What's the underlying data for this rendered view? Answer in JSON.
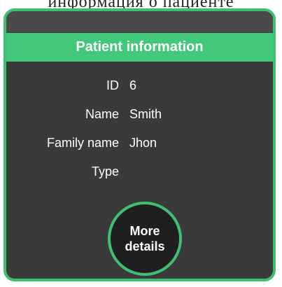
{
  "background_text": "информация о пациенте",
  "card": {
    "title": "Patient information",
    "fields": [
      {
        "label": "ID",
        "value": "6"
      },
      {
        "label": "Name",
        "value": "Smith"
      },
      {
        "label": "Family name",
        "value": "Jhon"
      },
      {
        "label": "Type",
        "value": ""
      }
    ],
    "more_button": {
      "line1": "More",
      "line2": "details"
    }
  },
  "colors": {
    "accent": "#42c87a",
    "card_bg": "#3a3a3a",
    "button_bg": "#1f1f1f",
    "text": "#ffffff"
  }
}
